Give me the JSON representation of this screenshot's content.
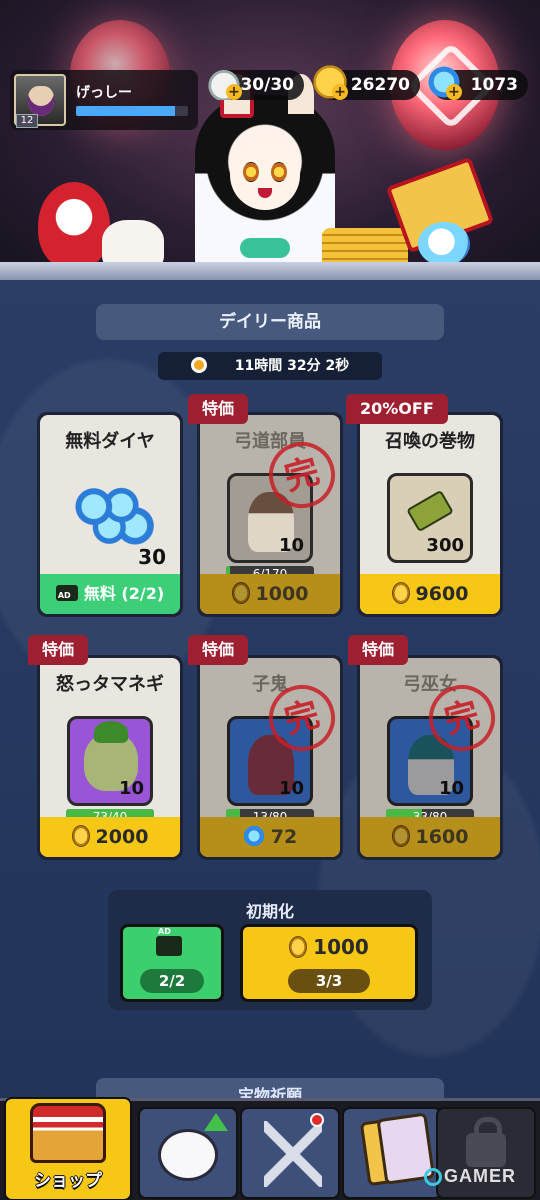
{
  "player": {
    "name": "げっしー",
    "level": "12",
    "exp_fraction": 0.88
  },
  "resources": {
    "stamina": "30/30",
    "gold": "26270",
    "gems": "1073"
  },
  "shop": {
    "section_title": "デイリー商品",
    "timer": "11時間 32分 2秒",
    "cards": [
      {
        "name": "無料ダイヤ",
        "ribbon": "",
        "qty": "30",
        "price_type": "ad",
        "price": "無料 (2/2)",
        "sold_out": false,
        "shards": ""
      },
      {
        "name": "弓道部員",
        "ribbon": "特価",
        "qty": "10",
        "price_type": "gold",
        "price": "1000",
        "sold_out": true,
        "shards": "6/170",
        "shard_fraction": 0.04
      },
      {
        "name": "召喚の巻物",
        "ribbon": "20%OFF",
        "qty": "300",
        "price_type": "gold",
        "price": "9600",
        "sold_out": false,
        "shards": ""
      },
      {
        "name": "怒っタマネギ",
        "ribbon": "特価",
        "qty": "10",
        "price_type": "gold",
        "price": "2000",
        "sold_out": false,
        "shards": "73/40",
        "shard_fraction": 1.0
      },
      {
        "name": "子鬼",
        "ribbon": "特価",
        "qty": "10",
        "price_type": "gem",
        "price": "72",
        "sold_out": true,
        "shards": "13/80",
        "shard_fraction": 0.16
      },
      {
        "name": "弓巫女",
        "ribbon": "特価",
        "qty": "10",
        "price_type": "gold",
        "price": "1600",
        "sold_out": true,
        "shards": "33/80",
        "shard_fraction": 0.41
      }
    ],
    "sold_out_stamp": "完",
    "reset": {
      "title": "初期化",
      "ad_count": "2/2",
      "coin_price": "1000",
      "coin_count": "3/3"
    },
    "next_section_title": "宝物祈願"
  },
  "nav": {
    "tabs": [
      {
        "label": "ショップ",
        "icon": "shop-stall-icon",
        "active": true
      },
      {
        "label": "",
        "icon": "bunny-upgrade-icon",
        "active": false
      },
      {
        "label": "",
        "icon": "crossed-swords-icon",
        "active": false
      },
      {
        "label": "",
        "icon": "cards-icon",
        "active": false
      },
      {
        "label": "",
        "icon": "lock-icon",
        "active": false
      }
    ]
  },
  "watermark": "GAMER",
  "colors": {
    "price_yellow": "#f6c715",
    "ad_green": "#3ccf78",
    "ribbon_red": "#9e1f2f",
    "panel_blue": "#2a3d66"
  }
}
